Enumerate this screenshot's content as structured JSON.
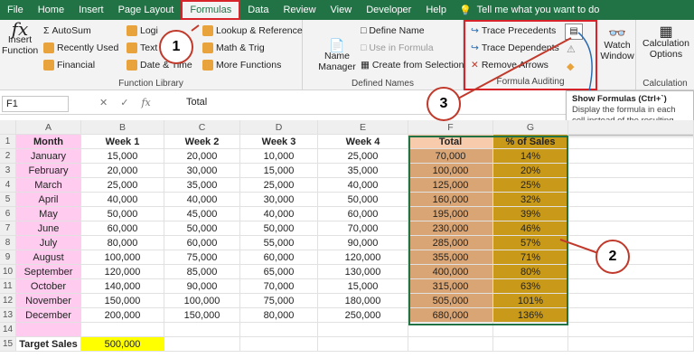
{
  "tabs": [
    "File",
    "Home",
    "Insert",
    "Page Layout",
    "Formulas",
    "Data",
    "Review",
    "View",
    "Developer",
    "Help"
  ],
  "tell_me": "Tell me what you want to do",
  "ribbon": {
    "insert_function": "Insert Function",
    "autosum": "AutoSum",
    "recently_used": "Recently Used",
    "financial": "Financial",
    "logical": "Logi",
    "text": "Text",
    "date_time": "Date & Time",
    "lookup": "Lookup & Reference",
    "math": "Math & Trig",
    "more": "More Functions",
    "function_library": "Function Library",
    "name_manager": "Name Manager",
    "define_name": "Define Name",
    "use_in_formula": "Use in Formula",
    "create_from_selection": "Create from Selection",
    "defined_names": "Defined Names",
    "trace_precedents": "Trace Precedents",
    "trace_dependents": "Trace Dependents",
    "remove_arrows": "Remove Arrows",
    "formula_auditing": "Formula Auditing",
    "watch_window": "Watch Window",
    "calc_options": "Calculation Options",
    "calculation": "Calculation"
  },
  "formula_bar": {
    "name_box": "F1",
    "fx": "fx",
    "value": "Total"
  },
  "tooltip": {
    "title": "Show Formulas (Ctrl+`)",
    "body": "Display the formula in each cell instead of the resulting value."
  },
  "columns": [
    "A",
    "B",
    "C",
    "D",
    "E",
    "F",
    "G"
  ],
  "headers": [
    "Month",
    "Week 1",
    "Week 2",
    "Week 3",
    "Week 4",
    "Total",
    "% of Sales"
  ],
  "rows": [
    [
      "January",
      "15,000",
      "20,000",
      "10,000",
      "25,000",
      "70,000",
      "14%"
    ],
    [
      "February",
      "20,000",
      "30,000",
      "15,000",
      "35,000",
      "100,000",
      "20%"
    ],
    [
      "March",
      "25,000",
      "35,000",
      "25,000",
      "40,000",
      "125,000",
      "25%"
    ],
    [
      "April",
      "40,000",
      "40,000",
      "30,000",
      "50,000",
      "160,000",
      "32%"
    ],
    [
      "May",
      "50,000",
      "45,000",
      "40,000",
      "60,000",
      "195,000",
      "39%"
    ],
    [
      "June",
      "60,000",
      "50,000",
      "50,000",
      "70,000",
      "230,000",
      "46%"
    ],
    [
      "July",
      "80,000",
      "60,000",
      "55,000",
      "90,000",
      "285,000",
      "57%"
    ],
    [
      "August",
      "100,000",
      "75,000",
      "60,000",
      "120,000",
      "355,000",
      "71%"
    ],
    [
      "September",
      "120,000",
      "85,000",
      "65,000",
      "130,000",
      "400,000",
      "80%"
    ],
    [
      "October",
      "140,000",
      "90,000",
      "70,000",
      "15,000",
      "315,000",
      "63%"
    ],
    [
      "November",
      "150,000",
      "100,000",
      "75,000",
      "180,000",
      "505,000",
      "101%"
    ],
    [
      "December",
      "200,000",
      "150,000",
      "80,000",
      "250,000",
      "680,000",
      "136%"
    ]
  ],
  "row_numbers": [
    "1",
    "2",
    "3",
    "4",
    "5",
    "6",
    "7",
    "8",
    "9",
    "10",
    "11",
    "12",
    "13",
    "14",
    "15"
  ],
  "target_label": "Target Sales",
  "target_value": "500,000",
  "callouts": [
    "1",
    "2",
    "3"
  ]
}
